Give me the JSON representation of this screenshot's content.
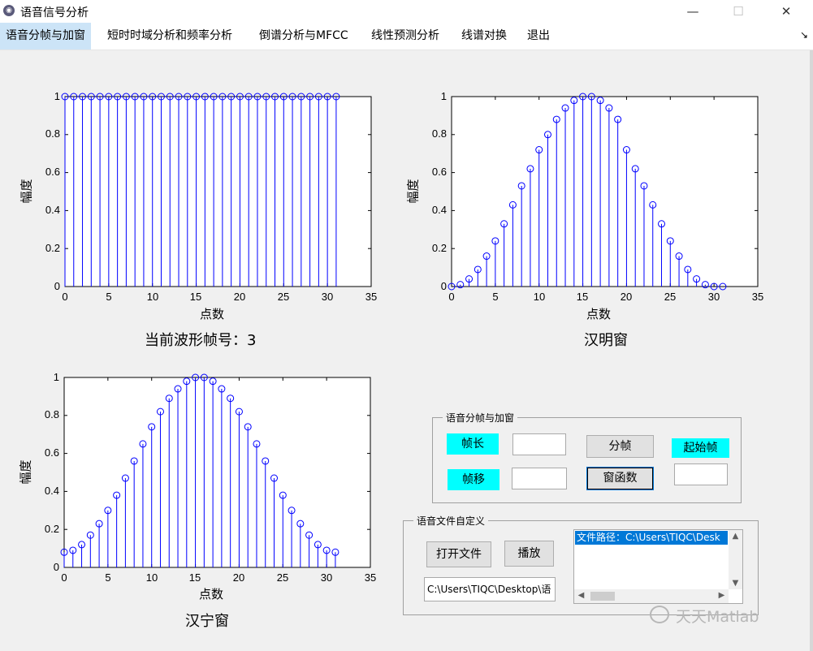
{
  "window": {
    "title": "语音信号分析",
    "minimize": "—",
    "maximize": "☐",
    "close": "✕"
  },
  "menu": {
    "items": [
      "语音分帧与加窗",
      "短时时域分析和频率分析",
      "倒谱分析与MFCC",
      "线性预测分析",
      "线谱对换",
      "退出"
    ],
    "active_index": 0,
    "overflow_icon": "↘"
  },
  "charts": {
    "top_left": {
      "ylabel": "幅度",
      "xlabel": "点数",
      "caption": "当前波形帧号：3",
      "xticks": [
        "0",
        "5",
        "10",
        "15",
        "20",
        "25",
        "30",
        "35"
      ],
      "yticks": [
        "0",
        "0.2",
        "0.4",
        "0.6",
        "0.8",
        "1"
      ]
    },
    "top_right": {
      "ylabel": "幅度",
      "xlabel": "点数",
      "caption": "汉明窗",
      "xticks": [
        "0",
        "5",
        "10",
        "15",
        "20",
        "25",
        "30",
        "35"
      ],
      "yticks": [
        "0",
        "0.2",
        "0.4",
        "0.6",
        "0.8",
        "1"
      ]
    },
    "bottom_left": {
      "ylabel": "幅度",
      "xlabel": "点数",
      "caption": "汉宁窗",
      "xticks": [
        "0",
        "5",
        "10",
        "15",
        "20",
        "25",
        "30",
        "35"
      ],
      "yticks": [
        "0",
        "0.2",
        "0.4",
        "0.6",
        "0.8",
        "1"
      ]
    }
  },
  "chart_data": [
    {
      "type": "stem",
      "series_color": "#0000ff",
      "xlim": [
        0,
        35
      ],
      "ylim": [
        0,
        1
      ],
      "x": [
        0,
        1,
        2,
        3,
        4,
        5,
        6,
        7,
        8,
        9,
        10,
        11,
        12,
        13,
        14,
        15,
        16,
        17,
        18,
        19,
        20,
        21,
        22,
        23,
        24,
        25,
        26,
        27,
        28,
        29,
        30,
        31
      ],
      "values": [
        1,
        1,
        1,
        1,
        1,
        1,
        1,
        1,
        1,
        1,
        1,
        1,
        1,
        1,
        1,
        1,
        1,
        1,
        1,
        1,
        1,
        1,
        1,
        1,
        1,
        1,
        1,
        1,
        1,
        1,
        1,
        1
      ]
    },
    {
      "type": "stem",
      "series_color": "#0000ff",
      "xlim": [
        0,
        35
      ],
      "ylim": [
        0,
        1
      ],
      "x": [
        0,
        1,
        2,
        3,
        4,
        5,
        6,
        7,
        8,
        9,
        10,
        11,
        12,
        13,
        14,
        15,
        16,
        17,
        18,
        19,
        20,
        21,
        22,
        23,
        24,
        25,
        26,
        27,
        28,
        29,
        30,
        31
      ],
      "values": [
        0.0,
        0.01,
        0.04,
        0.09,
        0.16,
        0.24,
        0.33,
        0.43,
        0.53,
        0.62,
        0.72,
        0.8,
        0.88,
        0.94,
        0.98,
        1.0,
        1.0,
        0.98,
        0.94,
        0.88,
        0.72,
        0.62,
        0.53,
        0.43,
        0.33,
        0.24,
        0.16,
        0.09,
        0.04,
        0.01,
        0.0,
        0.0
      ]
    },
    {
      "type": "stem",
      "series_color": "#0000ff",
      "xlim": [
        0,
        35
      ],
      "ylim": [
        0,
        1
      ],
      "x": [
        0,
        1,
        2,
        3,
        4,
        5,
        6,
        7,
        8,
        9,
        10,
        11,
        12,
        13,
        14,
        15,
        16,
        17,
        18,
        19,
        20,
        21,
        22,
        23,
        24,
        25,
        26,
        27,
        28,
        29,
        30,
        31
      ],
      "values": [
        0.08,
        0.09,
        0.12,
        0.17,
        0.23,
        0.3,
        0.38,
        0.47,
        0.56,
        0.65,
        0.74,
        0.82,
        0.89,
        0.94,
        0.98,
        1.0,
        1.0,
        0.98,
        0.94,
        0.89,
        0.82,
        0.74,
        0.65,
        0.56,
        0.47,
        0.38,
        0.3,
        0.23,
        0.17,
        0.12,
        0.09,
        0.08
      ]
    }
  ],
  "framing_panel": {
    "title": "语音分帧与加窗",
    "frame_length_label": "帧长",
    "frame_length_value": "",
    "frame_shift_label": "帧移",
    "frame_shift_value": "",
    "split_button": "分帧",
    "window_button": "窗函数",
    "start_frame_label": "起始帧",
    "start_frame_value": ""
  },
  "file_panel": {
    "title": "语音文件自定义",
    "open_button": "打开文件",
    "play_button": "播放",
    "path_value": "C:\\Users\\TIQC\\Desktop\\语",
    "list_item": "文件路径：C:\\Users\\TIQC\\Desk"
  },
  "watermark": {
    "text": "天天Matlab"
  }
}
